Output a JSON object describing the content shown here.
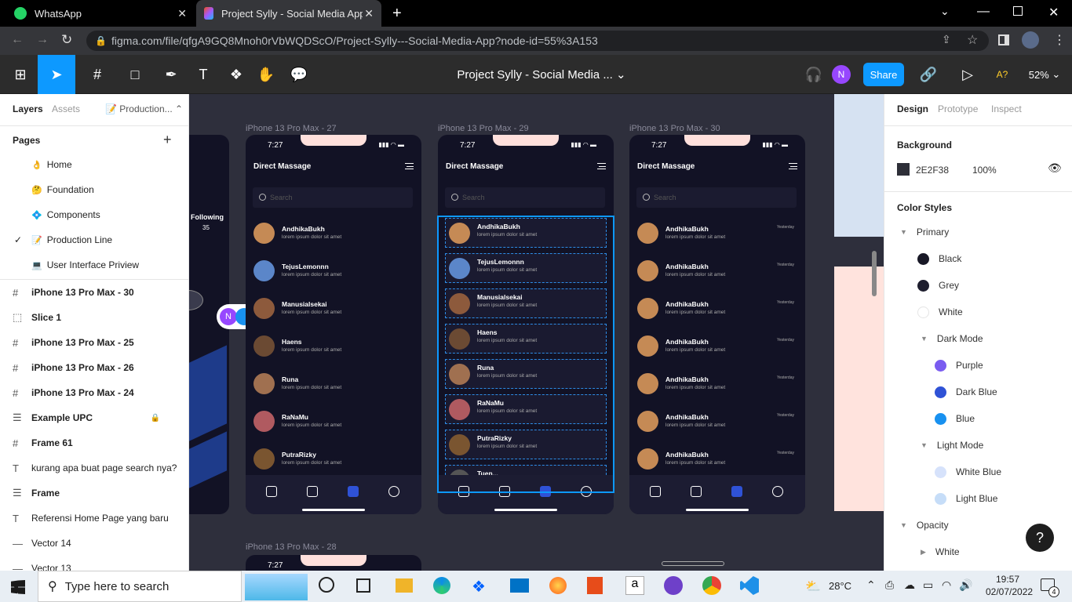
{
  "browser": {
    "tabs": [
      {
        "label": "WhatsApp"
      },
      {
        "label": "Project Sylly - Social Media App -"
      }
    ],
    "url": "figma.com/file/qfgA9GQ8Mnoh0rVbWQDScO/Project-Sylly---Social-Media-App?node-id=55%3A153",
    "url_host": "figma.com"
  },
  "figma": {
    "title": "Project Sylly - Social Media ...",
    "share": "Share",
    "zoom": "52%",
    "avatar": "N",
    "a11y": "A?"
  },
  "left": {
    "tabs": [
      "Layers",
      "Assets"
    ],
    "page_select": "Production...",
    "pages_title": "Pages",
    "pages": [
      {
        "icon": "👌",
        "label": "Home"
      },
      {
        "icon": "🤔",
        "label": "Foundation"
      },
      {
        "icon": "💠",
        "label": "Components"
      },
      {
        "icon": "📝",
        "label": "Production Line"
      },
      {
        "icon": "💻",
        "label": "User Interface Priview"
      }
    ],
    "layers": [
      {
        "icon": "#",
        "label": "iPhone 13 Pro Max - 30"
      },
      {
        "icon": "⬚",
        "label": "Slice 1"
      },
      {
        "icon": "#",
        "label": "iPhone 13 Pro Max - 25"
      },
      {
        "icon": "#",
        "label": "iPhone 13 Pro Max - 26"
      },
      {
        "icon": "#",
        "label": "iPhone 13 Pro Max - 24"
      },
      {
        "icon": "☰",
        "label": "Example UPC"
      },
      {
        "icon": "#",
        "label": "Frame 61"
      },
      {
        "icon": "T",
        "label": "kurang apa buat page search nya?"
      },
      {
        "icon": "☰",
        "label": "Frame"
      },
      {
        "icon": "T",
        "label": "Referensi Home Page yang baru"
      },
      {
        "icon": "—",
        "label": "Vector 14"
      },
      {
        "icon": "—",
        "label": "Vector 13"
      }
    ]
  },
  "right": {
    "tabs": [
      "Design",
      "Prototype",
      "Inspect"
    ],
    "background_title": "Background",
    "bg_hex": "2E2F38",
    "bg_opacity": "100%",
    "color_styles_title": "Color Styles",
    "primary": "Primary",
    "black": "Black",
    "grey": "Grey",
    "white": "White",
    "dark_mode": "Dark Mode",
    "purple": "Purple",
    "dark_blue": "Dark Blue",
    "blue": "Blue",
    "light_mode": "Light Mode",
    "white_blue": "White Blue",
    "light_blue": "Light Blue",
    "opacity": "Opacity",
    "op_white": "White",
    "colors": {
      "black": "#181826",
      "grey": "#1e1e2e",
      "purple": "#7a5cf0",
      "dark_blue": "#2f52d6",
      "blue": "#1891f0",
      "white_blue": "#d6e2fb",
      "light_blue": "#c6ddf8"
    }
  },
  "canvas": {
    "following": "Following",
    "following_count": "35",
    "frames": [
      {
        "label": "iPhone 13 Pro Max - 27"
      },
      {
        "label": "iPhone 13 Pro Max - 29"
      },
      {
        "label": "iPhone 13 Pro Max - 30"
      },
      {
        "label": "iPhone 13 Pro Max - 28"
      }
    ],
    "time": "7:27",
    "header": "Direct Massage",
    "search": "Search",
    "chats": [
      {
        "name": "AndhikaBukh",
        "msg": "lorem ipsum dolor sit amet"
      },
      {
        "name": "TejusLemonnn",
        "msg": "lorem ipsum dolor sit amet"
      },
      {
        "name": "Manusialsekai",
        "msg": "lorem ipsum dolor sit amet"
      },
      {
        "name": "Haens",
        "msg": "lorem ipsum dolor sit amet"
      },
      {
        "name": "Runa",
        "msg": "lorem ipsum dolor sit amet"
      },
      {
        "name": "RaNaMu",
        "msg": "lorem ipsum dolor sit amet"
      },
      {
        "name": "PutraRizky",
        "msg": "lorem ipsum dolor sit amet"
      },
      {
        "name": "Tuen...",
        "msg": ""
      }
    ],
    "repeat_name": "AndhikaBukh",
    "repeat_msg": "lorem ipsum dolor sit amet",
    "yesterday": "Yesterday"
  },
  "taskbar": {
    "search": "Type here to search",
    "temp": "28°C",
    "time": "19:57",
    "date": "02/07/2022",
    "notif": "4"
  }
}
